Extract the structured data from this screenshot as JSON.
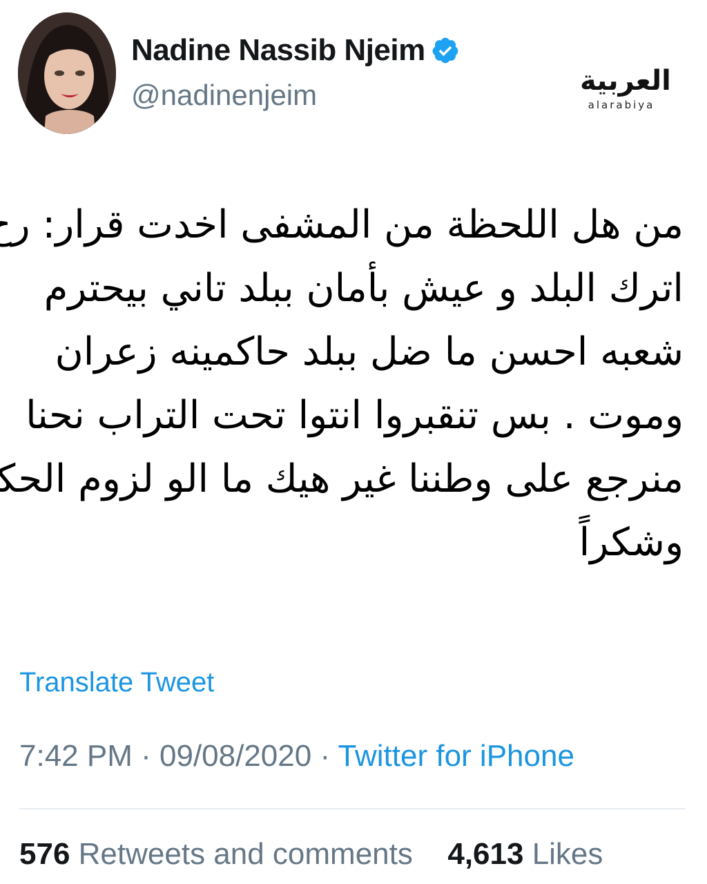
{
  "author": {
    "display_name": "Nadine Nassib Njeim",
    "handle": "@nadinenjeim",
    "verified": true,
    "avatar": "profile-photo"
  },
  "watermark": {
    "arabic": "العربية",
    "latin": "alarabiya"
  },
  "tweet": {
    "lines": [
      "من هل اللحظة من المشفى اخدت قرار: رح",
      "اترك البلد و عيش بأمان ببلد تاني بيحترم",
      "شعبه احسن ما ضل ببلد حاكمينه زعران",
      "وموت . بس تنقبروا انتوا تحت التراب نحنا",
      "منرجع على وطننا غير هيك ما الو لزوم الحكي",
      "وشكراً"
    ],
    "translate_label": "Translate Tweet",
    "time": "7:42 PM",
    "date": "09/08/2020",
    "separator": "·",
    "source": "Twitter for iPhone"
  },
  "stats": {
    "retweets_count": "576",
    "retweets_label": "Retweets and comments",
    "likes_count": "4,613",
    "likes_label": "Likes"
  },
  "colors": {
    "link_blue": "#1b95e0",
    "secondary_gray": "#657786",
    "verified_blue": "#1da1f2"
  }
}
